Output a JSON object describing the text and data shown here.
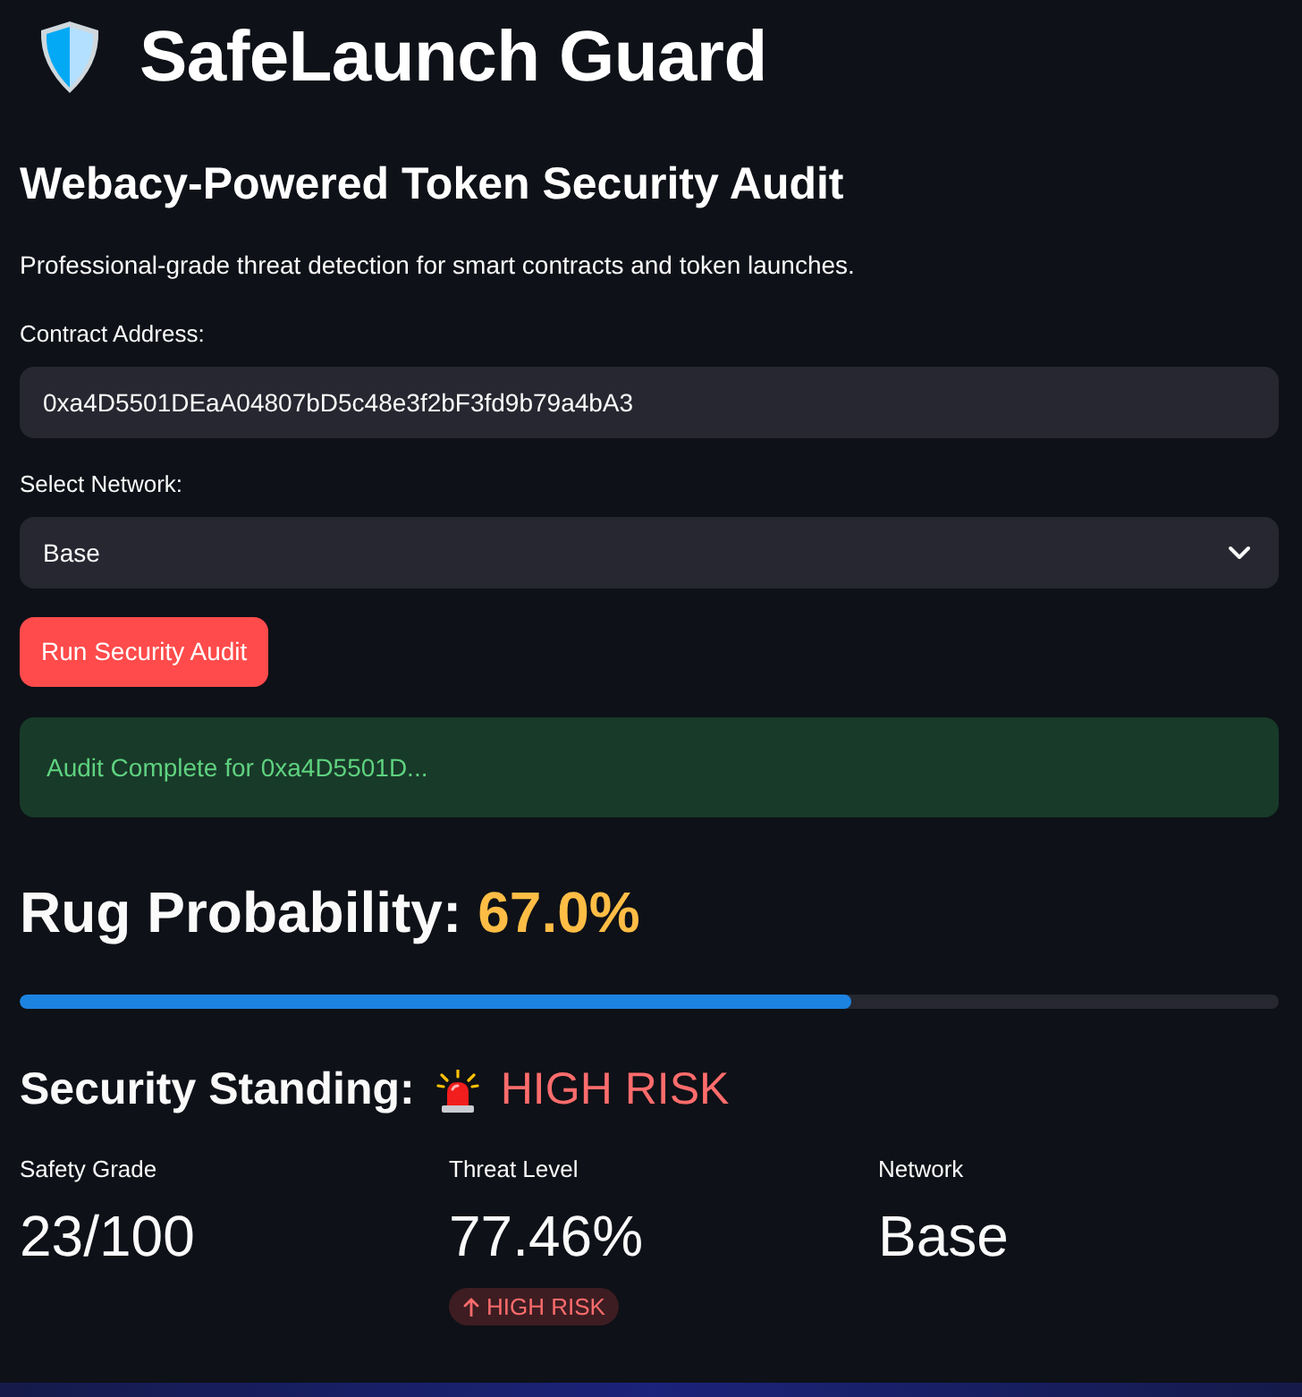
{
  "header": {
    "title": "SafeLaunch Guard"
  },
  "subtitle": "Webacy-Powered Token Security Audit",
  "description": "Professional-grade threat detection for smart contracts and token launches.",
  "contract_address": {
    "label": "Contract Address:",
    "value": "0xa4D5501DEaA04807bD5c48e3f2bF3fd9b79a4bA3"
  },
  "network_select": {
    "label": "Select Network:",
    "value": "Base"
  },
  "run_button": {
    "label": "Run Security Audit"
  },
  "alert": {
    "kind": "success",
    "text": "Audit Complete for 0xa4D5501D..."
  },
  "rug_probability": {
    "label": "Rug Probability:",
    "value": "67.0%",
    "level": 0.66
  },
  "security_standing": {
    "label": "Security Standing:",
    "value": "HIGH RISK"
  },
  "metrics": [
    {
      "label": "Safety Grade",
      "value": "23/100"
    },
    {
      "label": "Threat Level",
      "value": "77.46%",
      "delta": {
        "text": "HIGH RISK"
      }
    },
    {
      "label": "Network",
      "value": "Base"
    }
  ]
}
